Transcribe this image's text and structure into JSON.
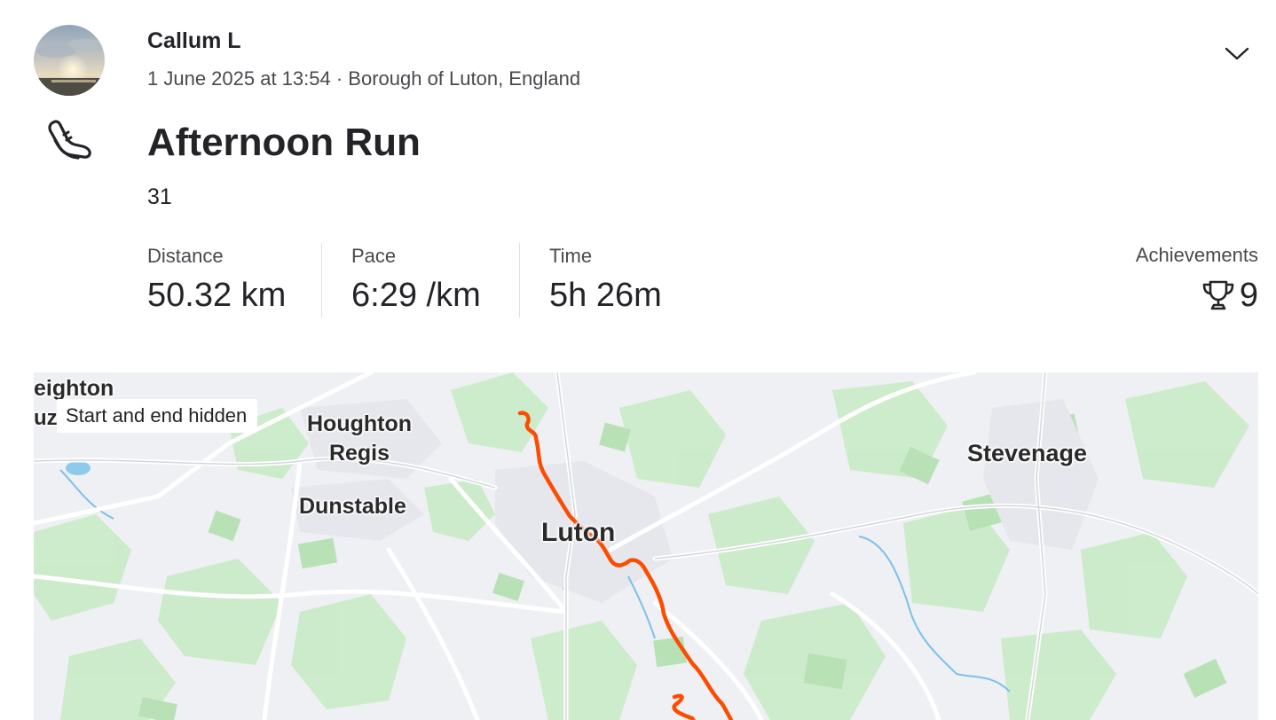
{
  "header": {
    "athlete_name": "Callum L",
    "date_location": "1 June 2025 at 13:54 · Borough of Luton, England",
    "avatar_icon": "avatar-photo-sunset",
    "collapse_icon": "chevron-down-icon"
  },
  "activity": {
    "sport_icon": "running-shoe-icon",
    "title": "Afternoon Run",
    "description": "31"
  },
  "stats": [
    {
      "label": "Distance",
      "value": "50.32 km"
    },
    {
      "label": "Pace",
      "value": "6:29 /km"
    },
    {
      "label": "Time",
      "value": "5h 26m"
    }
  ],
  "achievements": {
    "label": "Achievements",
    "icon": "trophy-icon",
    "count": "9"
  },
  "map": {
    "privacy_badge": "Start and end hidden",
    "places": {
      "leighton_fragment": "eighton",
      "leighton_fragment2": "uz",
      "houghton_regis": "Houghton\nRegis",
      "dunstable": "Dunstable",
      "luton": "Luton",
      "stevenage": "Stevenage"
    },
    "route_color": "#fc4c02",
    "colors": {
      "land": "#eef0f3",
      "green": "#c6e8c4",
      "water": "#7fc4ea",
      "road": "#ffffff"
    }
  }
}
